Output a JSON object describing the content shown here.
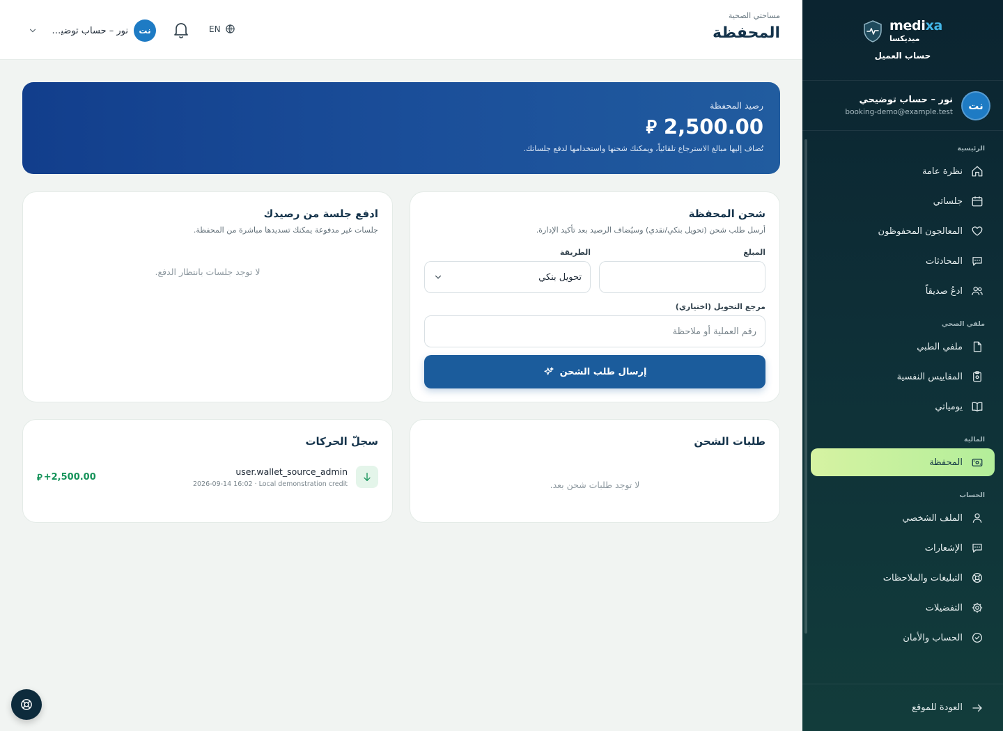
{
  "brand": {
    "name_en_prefix": "medi",
    "name_en_accent": "xa",
    "name_ar": "ميديكسا",
    "subtitle": "حساب العميل"
  },
  "user": {
    "initials": "نت",
    "name": "نور – حساب توضيحي",
    "email": "booking-demo@example.test",
    "chip_name": "نور – حساب توضيحي"
  },
  "sidebar": {
    "sections": [
      {
        "title": "الرئيسية",
        "items": [
          {
            "label": "نظرة عامة",
            "icon": "home-icon"
          },
          {
            "label": "جلساتي",
            "icon": "calendar-icon"
          },
          {
            "label": "المعالجون المحفوظون",
            "icon": "heart-icon"
          },
          {
            "label": "المحادثات",
            "icon": "chat-icon"
          },
          {
            "label": "ادعُ صديقاً",
            "icon": "users-icon"
          }
        ]
      },
      {
        "title": "ملفي الصحي",
        "items": [
          {
            "label": "ملفي الطبي",
            "icon": "file-icon"
          },
          {
            "label": "المقاييس النفسية",
            "icon": "clipboard-icon"
          },
          {
            "label": "يومياتي",
            "icon": "book-icon"
          }
        ]
      },
      {
        "title": "المالية",
        "items": [
          {
            "label": "المحفظة",
            "icon": "wallet-icon",
            "active": true
          }
        ]
      },
      {
        "title": "الحساب",
        "items": [
          {
            "label": "الملف الشخصي",
            "icon": "user-icon"
          },
          {
            "label": "الإشعارات",
            "icon": "message-icon"
          },
          {
            "label": "التبليغات والملاحظات",
            "icon": "lifebuoy-icon"
          },
          {
            "label": "التفضيلات",
            "icon": "gear-icon"
          },
          {
            "label": "الحساب والأمان",
            "icon": "shield-check-icon"
          }
        ]
      }
    ],
    "footer_label": "العودة للموقع"
  },
  "header": {
    "breadcrumb": "مساحتي الصحية",
    "title": "المحفظة",
    "lang": "EN"
  },
  "balance": {
    "label": "رصيد المحفظة",
    "amount": "2,500.00",
    "currency": "⃁",
    "note": "تُضاف إليها مبالغ الاسترجاع تلقائياً، ويمكنك شحنها واستخدامها لدفع جلساتك."
  },
  "topup": {
    "title": "شحن المحفظة",
    "subtitle": "أرسل طلب شحن (تحويل بنكي/نقدي) وسيُضاف الرصيد بعد تأكيد الإدارة.",
    "amount_label": "المبلغ",
    "amount_value": "",
    "method_label": "الطريقة",
    "method_value": "تحويل بنكي",
    "reference_label": "مرجع التحويل (اختياري)",
    "reference_placeholder": "رقم العملية أو ملاحظة",
    "submit_label": "إرسال طلب الشحن"
  },
  "pay_session": {
    "title": "ادفع جلسة من رصيدك",
    "subtitle": "جلسات غير مدفوعة يمكنك تسديدها مباشرة من المحفظة.",
    "empty": "لا توجد جلسات بانتظار الدفع."
  },
  "topup_requests": {
    "title": "طلبات الشحن",
    "empty": "لا توجد طلبات شحن بعد."
  },
  "transactions": {
    "title": "سجلّ الحركات",
    "items": [
      {
        "source": "user.wallet_source_admin",
        "meta": "2026-09-14 16:02 · Local demonstration credit",
        "amount": "+2,500.00",
        "currency": "⃁"
      }
    ]
  },
  "colors": {
    "sidebar_bg": "#0e2f37",
    "active_item": "#c8f2a0",
    "primary": "#1b5c9c",
    "balance_bg": "#1b4f9a",
    "positive": "#16935a",
    "brand_accent": "#43b7e8"
  }
}
